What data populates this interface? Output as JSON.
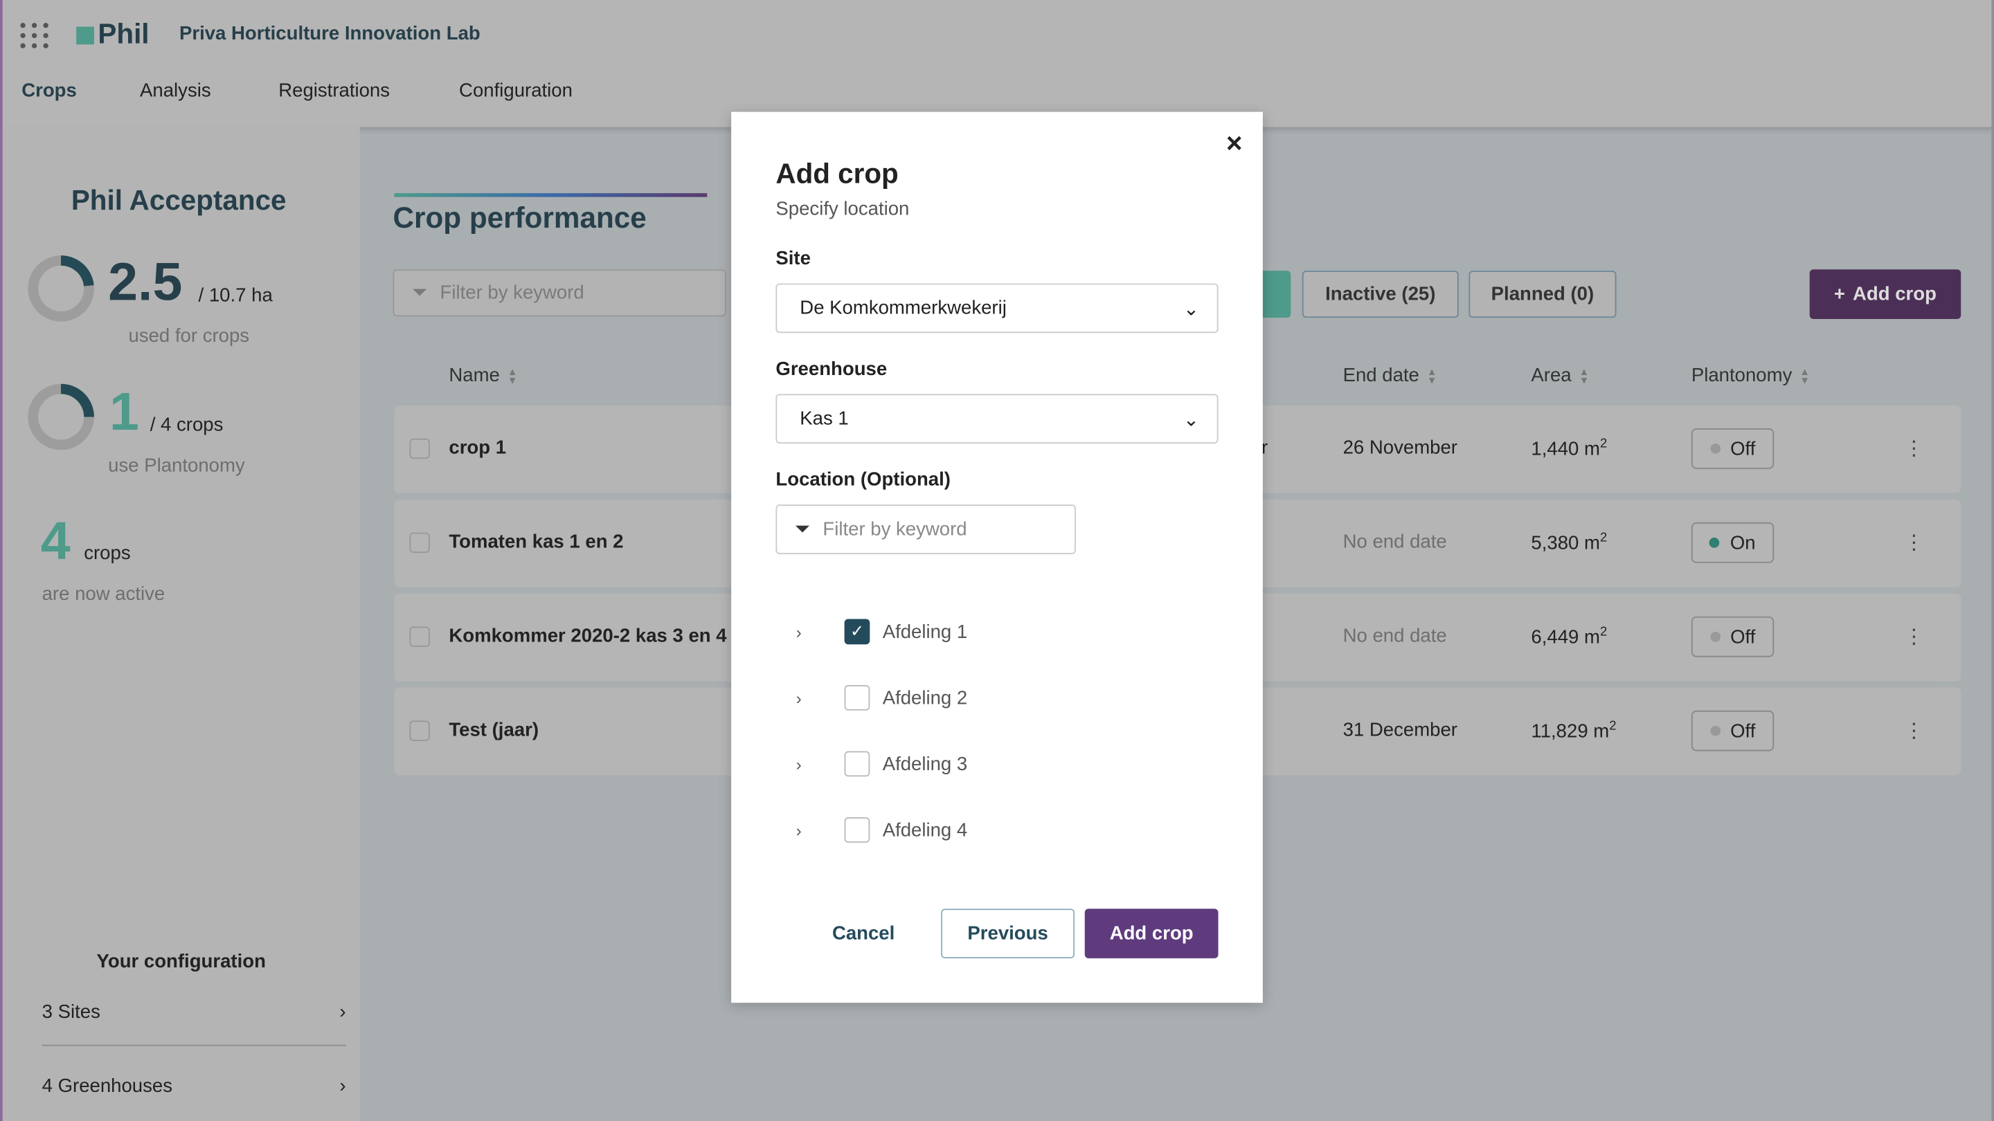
{
  "header": {
    "logo": "Phil",
    "org": "Priva Horticulture Innovation Lab",
    "nav": [
      "Crops",
      "Analysis",
      "Registrations",
      "Configuration"
    ],
    "active_nav": "Crops"
  },
  "sidebar": {
    "title": "Phil Acceptance",
    "stat1": {
      "value": "2.5",
      "total": "/ 10.7 ha",
      "caption": "used for crops",
      "fraction": 0.234
    },
    "stat2": {
      "value": "1",
      "total": "/ 4 crops",
      "caption": "use Plantonomy",
      "fraction": 0.25
    },
    "stat3": {
      "value": "4",
      "unit": "crops",
      "caption": "are now active"
    },
    "config_title": "Your configuration",
    "config_items": [
      "3 Sites",
      "4 Greenhouses"
    ]
  },
  "main": {
    "title": "Crop performance",
    "filter_placeholder": "Filter by keyword",
    "tabs": [
      "Inactive (25)",
      "Planned (0)"
    ],
    "add_crop": "Add crop",
    "columns": {
      "name": "Name",
      "end_date": "End date",
      "area": "Area",
      "plantonomy": "Plantonomy"
    },
    "rows": [
      {
        "name": "crop 1",
        "partial": "r",
        "end_date": "26 November",
        "area": "1,440 m",
        "plantonomy": "Off"
      },
      {
        "name": "Tomaten kas 1 en 2",
        "partial": "",
        "end_date": "No end date",
        "area": "5,380 m",
        "plantonomy": "On"
      },
      {
        "name": "Komkommer 2020-2 kas 3 en 4",
        "partial": "",
        "end_date": "No end date",
        "area": "6,449 m",
        "plantonomy": "Off"
      },
      {
        "name": "Test (jaar)",
        "partial": "",
        "end_date": "31 December",
        "area": "11,829 m",
        "plantonomy": "Off"
      }
    ],
    "area_sup": "2"
  },
  "modal": {
    "title": "Add crop",
    "subtitle": "Specify location",
    "site_label": "Site",
    "site_value": "De Komkommerkwekerij",
    "greenhouse_label": "Greenhouse",
    "greenhouse_value": "Kas 1",
    "location_label": "Location (Optional)",
    "location_placeholder": "Filter by keyword",
    "locations": [
      {
        "label": "Afdeling 1",
        "checked": true
      },
      {
        "label": "Afdeling 2",
        "checked": false
      },
      {
        "label": "Afdeling 3",
        "checked": false
      },
      {
        "label": "Afdeling 4",
        "checked": false
      }
    ],
    "cancel": "Cancel",
    "previous": "Previous",
    "add": "Add crop",
    "close": "×"
  },
  "colors": {
    "primary": "#5f3b7e",
    "accent": "#4e9a8b",
    "text_dark": "#263f4a"
  }
}
